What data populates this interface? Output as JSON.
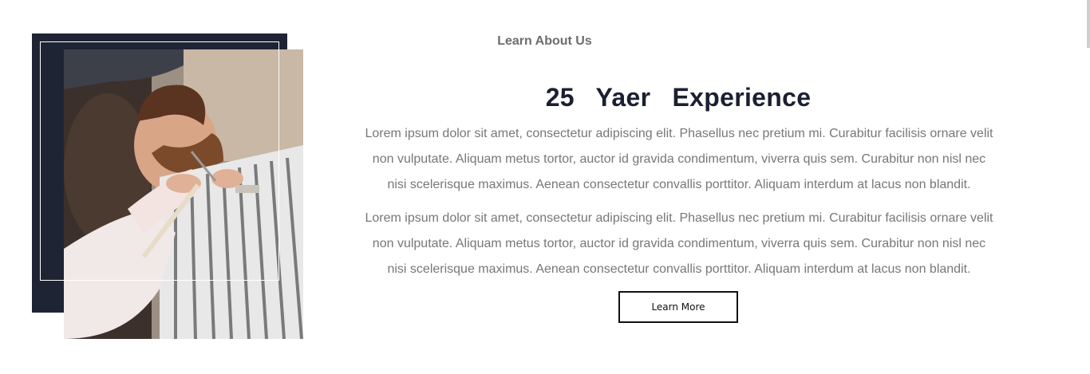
{
  "about": {
    "eyebrow": "Learn About Us",
    "headline": "25 Yaer Experience",
    "paragraphs": [
      "Lorem ipsum dolor sit amet, consectetur adipiscing elit. Phasellus nec pretium mi. Curabitur facilisis ornare velit non vulputate. Aliquam metus tortor, auctor id gravida condimentum, viverra quis sem. Curabitur non nisl nec nisi scelerisque maximus. Aenean consectetur convallis porttitor. Aliquam interdum at lacus non blandit.",
      "Lorem ipsum dolor sit amet, consectetur adipiscing elit. Phasellus nec pretium mi. Curabitur facilisis ornare velit non vulputate. Aliquam metus tortor, auctor id gravida condimentum, viverra quis sem. Curabitur non nisl nec nisi scelerisque maximus. Aenean consectetur convallis porttitor. Aliquam interdum at lacus non blandit."
    ],
    "button_label": "Learn More"
  },
  "colors": {
    "dark_panel": "#1f2434",
    "heading": "#1a2030",
    "body_text": "#777777",
    "eyebrow": "#6c6c6c"
  },
  "image": {
    "subject": "barber trimming a man's beard"
  }
}
